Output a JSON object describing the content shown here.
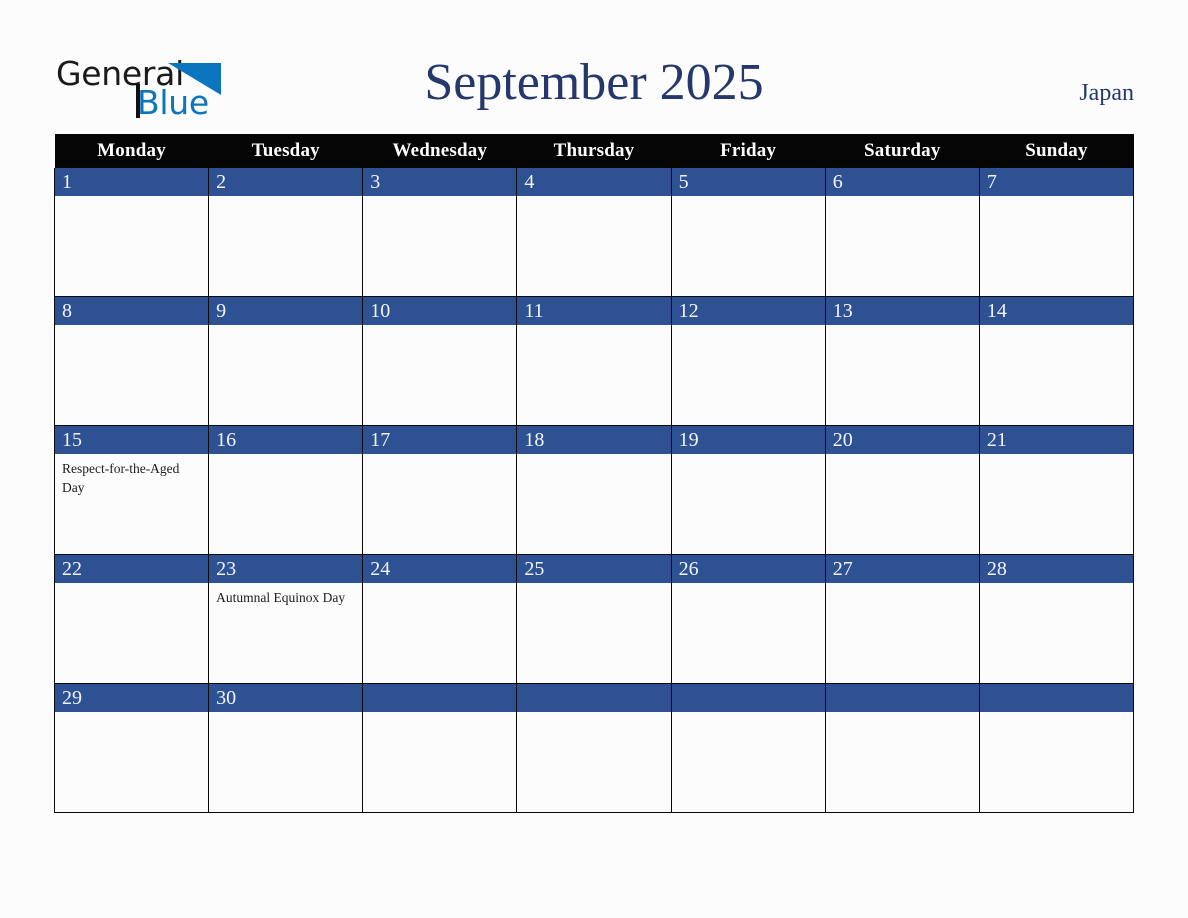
{
  "brand": {
    "word_one": "General",
    "word_two": "Blue",
    "accent_color": "#0b76bd"
  },
  "header": {
    "title": "September 2025",
    "country": "Japan",
    "title_color": "#24386b"
  },
  "calendar": {
    "weekday_headers": [
      "Monday",
      "Tuesday",
      "Wednesday",
      "Thursday",
      "Friday",
      "Saturday",
      "Sunday"
    ],
    "header_bg": "#050505",
    "daynum_bg": "#2d5193",
    "weeks": [
      [
        {
          "day": "1",
          "events": []
        },
        {
          "day": "2",
          "events": []
        },
        {
          "day": "3",
          "events": []
        },
        {
          "day": "4",
          "events": []
        },
        {
          "day": "5",
          "events": []
        },
        {
          "day": "6",
          "events": []
        },
        {
          "day": "7",
          "events": []
        }
      ],
      [
        {
          "day": "8",
          "events": []
        },
        {
          "day": "9",
          "events": []
        },
        {
          "day": "10",
          "events": []
        },
        {
          "day": "11",
          "events": []
        },
        {
          "day": "12",
          "events": []
        },
        {
          "day": "13",
          "events": []
        },
        {
          "day": "14",
          "events": []
        }
      ],
      [
        {
          "day": "15",
          "events": [
            "Respect-for-the-Aged Day"
          ]
        },
        {
          "day": "16",
          "events": []
        },
        {
          "day": "17",
          "events": []
        },
        {
          "day": "18",
          "events": []
        },
        {
          "day": "19",
          "events": []
        },
        {
          "day": "20",
          "events": []
        },
        {
          "day": "21",
          "events": []
        }
      ],
      [
        {
          "day": "22",
          "events": []
        },
        {
          "day": "23",
          "events": [
            "Autumnal Equinox Day"
          ]
        },
        {
          "day": "24",
          "events": []
        },
        {
          "day": "25",
          "events": []
        },
        {
          "day": "26",
          "events": []
        },
        {
          "day": "27",
          "events": []
        },
        {
          "day": "28",
          "events": []
        }
      ],
      [
        {
          "day": "29",
          "events": []
        },
        {
          "day": "30",
          "events": []
        },
        {
          "day": "",
          "events": []
        },
        {
          "day": "",
          "events": []
        },
        {
          "day": "",
          "events": []
        },
        {
          "day": "",
          "events": []
        },
        {
          "day": "",
          "events": []
        }
      ]
    ]
  }
}
